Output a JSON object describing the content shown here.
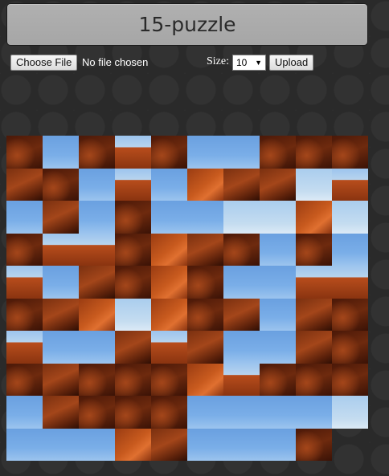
{
  "header": {
    "title": "15-puzzle"
  },
  "controls": {
    "choose_file_label": "Choose File",
    "file_status": "No file chosen",
    "size_label": "Size:",
    "size_value": "10",
    "upload_label": "Upload"
  },
  "board": {
    "size": 10,
    "empty_position": "bottom-right",
    "tiles": [
      "rock-dark",
      "sky",
      "rock-dark",
      "butte",
      "rock-dark",
      "sky",
      "sky",
      "rock-dark",
      "rock-dark",
      "rock-dark",
      "rock-mid",
      "rock-dark",
      "sky",
      "butte",
      "sky",
      "rock-bright",
      "rock-mid",
      "rock-mid",
      "sky-light",
      "butte",
      "sky",
      "rock-mid",
      "sky",
      "rock-dark",
      "sky",
      "sky",
      "sky-light",
      "sky-light",
      "rock-bright",
      "sky-light",
      "rock-dark",
      "butte",
      "butte",
      "rock-dark",
      "rock-bright",
      "rock-mid",
      "rock-dark",
      "sky",
      "rock-dark",
      "sky",
      "butte",
      "sky",
      "rock-mid",
      "rock-dark",
      "rock-bright",
      "rock-dark",
      "sky",
      "sky",
      "butte",
      "butte",
      "rock-dark",
      "rock-mid",
      "rock-bright",
      "sky-light",
      "rock-bright",
      "rock-dark",
      "rock-mid",
      "sky",
      "rock-mid",
      "rock-dark",
      "butte",
      "sky",
      "sky",
      "rock-mid",
      "butte",
      "rock-mid",
      "sky",
      "sky",
      "rock-mid",
      "rock-dark",
      "rock-dark",
      "rock-mid",
      "rock-dark",
      "rock-dark",
      "rock-dark",
      "rock-bright",
      "butte",
      "rock-dark",
      "rock-dark",
      "rock-dark",
      "sky",
      "rock-mid",
      "rock-dark",
      "rock-dark",
      "rock-dark",
      "sky",
      "sky",
      "sky",
      "sky",
      "sky-light",
      "sky",
      "sky",
      "sky",
      "rock-bright",
      "rock-mid",
      "sky",
      "sky",
      "sky",
      "rock-dark",
      "empty"
    ]
  },
  "colors": {
    "rock-dark": "#6e2a0e",
    "rock-mid": "#a4461a",
    "rock-bright": "#c85a1e",
    "sky": "#7aaee8",
    "sky-light": "#c4dcf0",
    "butte": "#b84d1c"
  }
}
